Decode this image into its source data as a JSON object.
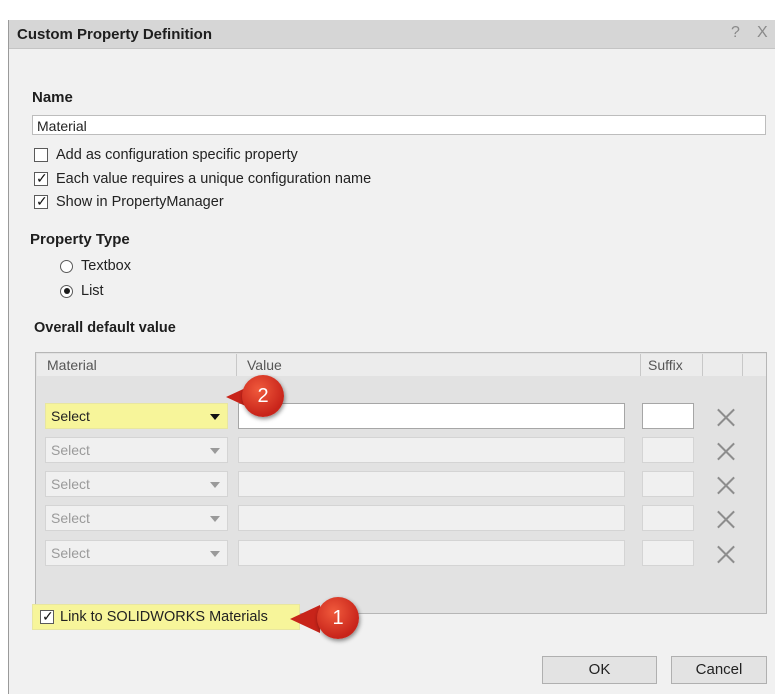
{
  "dialog": {
    "title": "Custom Property Definition",
    "help_glyph": "?",
    "close_glyph": "X"
  },
  "name_section": {
    "label": "Name",
    "value": "Material"
  },
  "options": {
    "config_specific": {
      "label": "Add as configuration specific property",
      "checked": false
    },
    "unique_config_name": {
      "label": "Each value requires a unique configuration name",
      "checked": true
    },
    "show_in_pm": {
      "label": "Show in PropertyManager",
      "checked": true
    }
  },
  "property_type": {
    "label": "Property Type",
    "textbox_label": "Textbox",
    "list_label": "List",
    "selected": "List"
  },
  "default_value": {
    "label": "Overall default value",
    "columns": {
      "material": "Material",
      "value": "Value",
      "suffix": "Suffix"
    },
    "rows": [
      {
        "material": "Select",
        "value": "",
        "suffix": "",
        "active": true
      },
      {
        "material": "Select",
        "value": "",
        "suffix": "",
        "active": false
      },
      {
        "material": "Select",
        "value": "",
        "suffix": "",
        "active": false
      },
      {
        "material": "Select",
        "value": "",
        "suffix": "",
        "active": false
      },
      {
        "material": "Select",
        "value": "",
        "suffix": "",
        "active": false
      }
    ]
  },
  "link_materials": {
    "label": "Link to SOLIDWORKS Materials",
    "checked": true
  },
  "buttons": {
    "ok": "OK",
    "cancel": "Cancel"
  },
  "callouts": {
    "first": "1",
    "second": "2"
  },
  "colors": {
    "highlight": "#f7f59a",
    "callout": "#d9362b"
  },
  "check_glyph": "✓"
}
